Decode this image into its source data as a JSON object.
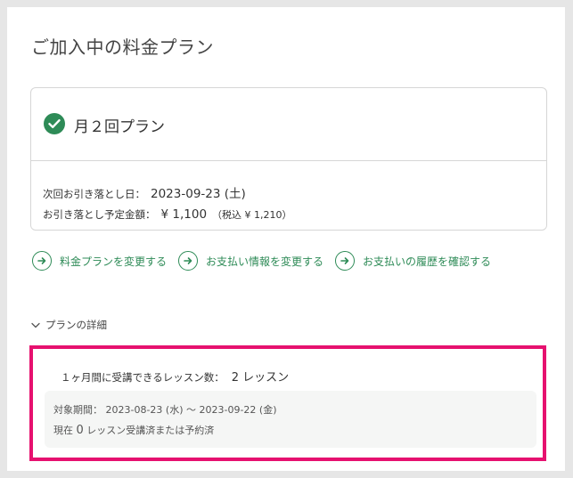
{
  "page_title": "ご加入中の料金プラン",
  "plan": {
    "name": "月２回プラン",
    "next_billing_label": "次回お引き落とし日：",
    "next_billing_value": "2023-09-23 (土)",
    "amount_label": "お引き落とし予定金額：",
    "amount_value": "¥ 1,100",
    "amount_tax": "（税込 ¥ 1,210）"
  },
  "links": [
    {
      "label": "料金プランを変更する",
      "icon": "arrow-right-icon"
    },
    {
      "label": "お支払い情報を変更する",
      "icon": "arrow-right-icon"
    },
    {
      "label": "お支払いの履歴を確認する",
      "icon": "arrow-right-icon"
    }
  ],
  "details": {
    "toggle_label": "プランの詳細",
    "lessons_label": "１ヶ月間に受講できるレッスン数：",
    "lessons_value": "2 レッスン",
    "period_label": "対象期間：",
    "period_value": "2023-08-23 (水) ～ 2023-09-22 (金)",
    "current_prefix": "現在",
    "current_count": "0",
    "current_suffix": "レッスン受講済または予約済"
  },
  "colors": {
    "accent": "#2e8b57",
    "highlight": "#e6116f"
  }
}
